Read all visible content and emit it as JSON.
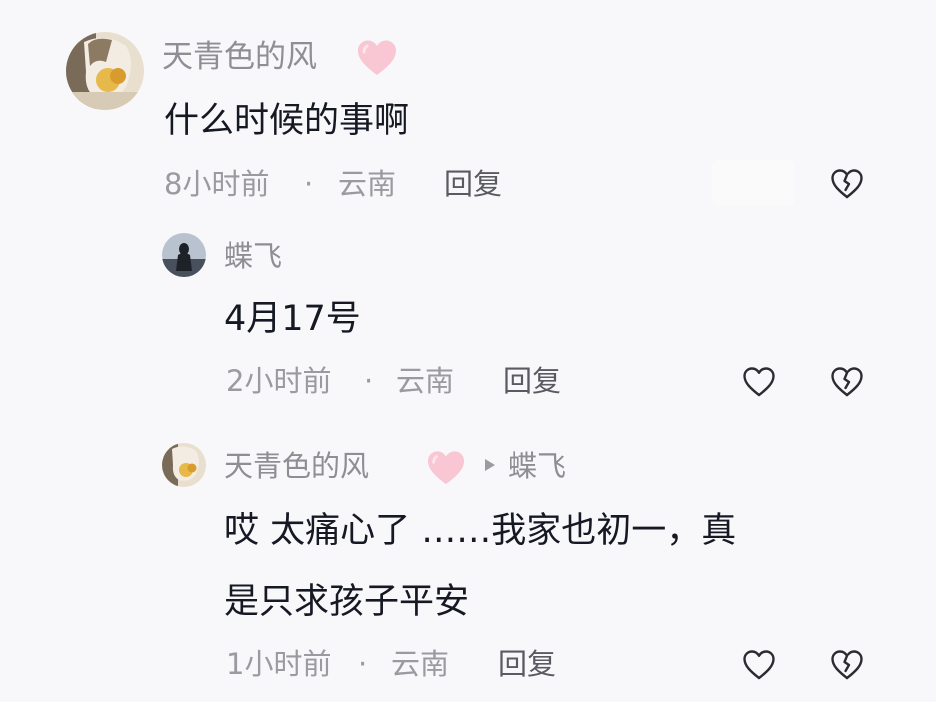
{
  "comments": [
    {
      "author": "天青色的风",
      "author_badge": "pink-heart-icon",
      "text": "什么时候的事啊",
      "meta_time": "8小时前",
      "meta_sep": "·",
      "meta_location": "云南",
      "reply_label": "回复",
      "actions": [
        "dislike-heart-icon"
      ]
    },
    {
      "author": "蝶飞",
      "text": "4月17号",
      "meta_time": "2小时前",
      "meta_sep": "·",
      "meta_location": "云南",
      "reply_label": "回复",
      "actions": [
        "like-heart-icon",
        "dislike-heart-icon"
      ]
    },
    {
      "author": "天青色的风",
      "author_badge": "pink-heart-icon",
      "reply_to": "蝶飞",
      "text_line1": "哎 太痛心了 ……我家也初一，真",
      "text_line2": "是只求孩子平安",
      "meta_time": "1小时前",
      "meta_sep": "·",
      "meta_location": "云南",
      "reply_label": "回复",
      "actions": [
        "like-heart-icon",
        "dislike-heart-icon"
      ]
    }
  ],
  "colors": {
    "background": "#f8f8fa",
    "text_primary": "#161823",
    "text_secondary": "#9a9aa0",
    "badge_pink": "#f9c6d3"
  }
}
